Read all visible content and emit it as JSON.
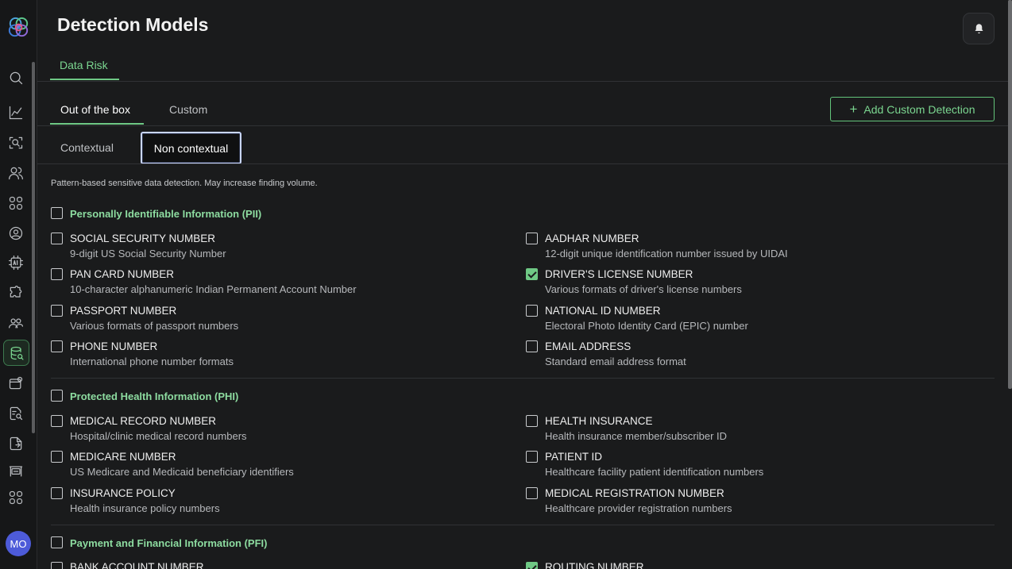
{
  "page": {
    "title": "Detection Models"
  },
  "sidebar": {
    "icons": [
      "search-icon",
      "analytics-icon",
      "scan-icon",
      "users-icon",
      "apps-icon",
      "user-circle-icon",
      "ai-icon",
      "plugin-icon",
      "groups-icon",
      "data-risk-icon",
      "wallet-icon",
      "document-search-icon",
      "file-icon",
      "server-icon",
      "grid-icon"
    ],
    "active": "data-risk-icon",
    "avatar": "MO"
  },
  "tabs": {
    "top": "Data Risk",
    "main": [
      "Out of the box",
      "Custom"
    ],
    "sub": [
      "Contextual",
      "Non contextual"
    ]
  },
  "add_button": "Add Custom Detection",
  "description": "Pattern-based sensitive data detection. May increase finding volume.",
  "categories": [
    {
      "title": "Personally Identifiable Information (PII)",
      "checked": false,
      "items": [
        {
          "title": "SOCIAL SECURITY NUMBER",
          "sub": "9-digit US Social Security Number",
          "checked": false
        },
        {
          "title": "AADHAR NUMBER",
          "sub": "12-digit unique identification number issued by UIDAI",
          "checked": false
        },
        {
          "title": "PAN CARD NUMBER",
          "sub": "10-character alphanumeric Indian Permanent Account Number",
          "checked": false
        },
        {
          "title": "DRIVER'S LICENSE NUMBER",
          "sub": "Various formats of driver's license numbers",
          "checked": true
        },
        {
          "title": "PASSPORT NUMBER",
          "sub": "Various formats of passport numbers",
          "checked": false
        },
        {
          "title": "NATIONAL ID NUMBER",
          "sub": "Electoral Photo Identity Card (EPIC) number",
          "checked": false
        },
        {
          "title": "PHONE NUMBER",
          "sub": "International phone number formats",
          "checked": false
        },
        {
          "title": "EMAIL ADDRESS",
          "sub": "Standard email address format",
          "checked": false
        }
      ]
    },
    {
      "title": "Protected Health Information (PHI)",
      "checked": false,
      "items": [
        {
          "title": "MEDICAL RECORD NUMBER",
          "sub": "Hospital/clinic medical record numbers",
          "checked": false
        },
        {
          "title": "HEALTH INSURANCE",
          "sub": "Health insurance member/subscriber ID",
          "checked": false
        },
        {
          "title": "MEDICARE NUMBER",
          "sub": "US Medicare and Medicaid beneficiary identifiers",
          "checked": false
        },
        {
          "title": "PATIENT ID",
          "sub": "Healthcare facility patient identification numbers",
          "checked": false
        },
        {
          "title": "INSURANCE POLICY",
          "sub": "Health insurance policy numbers",
          "checked": false
        },
        {
          "title": "MEDICAL REGISTRATION NUMBER",
          "sub": "Healthcare provider registration numbers",
          "checked": false
        }
      ]
    },
    {
      "title": "Payment and Financial Information (PFI)",
      "checked": false,
      "items": [
        {
          "title": "BANK ACCOUNT NUMBER",
          "checked": false
        },
        {
          "title": "ROUTING NUMBER",
          "checked": true
        }
      ]
    }
  ],
  "colors": {
    "accent": "#6fc985",
    "background": "#1a1b1c",
    "focus_ring": "#c9d6ff"
  }
}
